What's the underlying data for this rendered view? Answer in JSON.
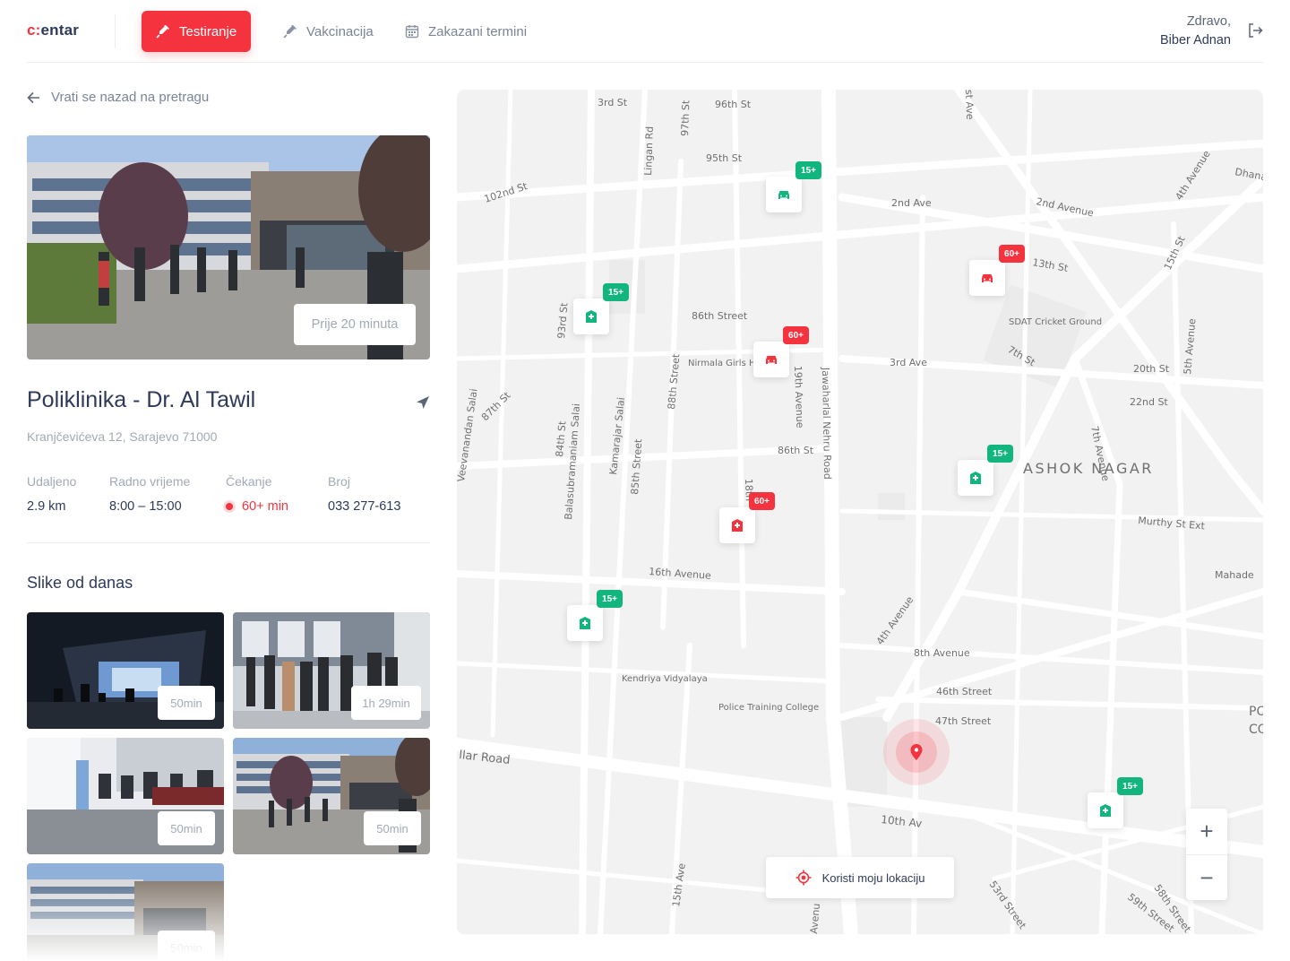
{
  "header": {
    "logo_prefix": "c",
    "logo_suffix": "entar",
    "nav": [
      {
        "label": "Testiranje",
        "icon": "syringe-icon",
        "active": true
      },
      {
        "label": "Vakcinacija",
        "icon": "vaccine-icon",
        "active": false
      },
      {
        "label": "Zakazani termini",
        "icon": "calendar-icon",
        "active": false
      }
    ],
    "greeting": "Zdravo,",
    "user_name": "Biber Adnan",
    "logout_icon": "logout-icon"
  },
  "detail": {
    "back_label": "Vrati se nazad na pretragu",
    "hero_time": "Prije 20 minuta",
    "title": "Poliklinika - Dr. Al Tawil",
    "address": "Kranjčevićeva 12, Sarajevo 71000",
    "stats": [
      {
        "label": "Udaljeno",
        "value": "2.9 km"
      },
      {
        "label": "Radno vrijeme",
        "value": "8:00 – 15:00"
      },
      {
        "label": "Čekanje",
        "value": "60+ min"
      },
      {
        "label": "Broj",
        "value": "033 277-613"
      }
    ],
    "photos_title": "Slike od danas",
    "photos": [
      {
        "time": "50min"
      },
      {
        "time": "1h 29min"
      },
      {
        "time": "50min"
      },
      {
        "time": "50min"
      },
      {
        "time": "50min"
      }
    ]
  },
  "map": {
    "streets": [
      "3rd St",
      "96th St",
      "97th St",
      "Lingan Rd",
      "95th St",
      "102nd St",
      "2nd Ave",
      "2nd Avenue",
      "4th Avenue",
      "Dhana",
      "13th St",
      "15th St",
      "86th Street",
      "93rd St",
      "Nirmala Girls HSS",
      "3rd Ave",
      "SDAT Cricket Ground",
      "7th St",
      "20th St",
      "22nd St",
      "5th Avenue",
      "19th Avenue",
      "Jawaharlal Nehru Road",
      "88th Street",
      "87th St",
      "86th St",
      "84th St",
      "Balasubramaniam Salai",
      "Kamarajar Salai",
      "85th Street",
      "ASHOK NAGAR",
      "7th Avenue",
      "Murthy St Ext",
      "18th",
      "16th Avenue",
      "Mahade",
      "4th Avenue",
      "8th Avenue",
      "46th Street",
      "47th Street",
      "Kendriya Vidyalaya",
      "Police Training College",
      "llar Road",
      "10th Av",
      "15th Ave",
      "53rd Street",
      "58th Street",
      "59th Street",
      "PO",
      "CO",
      "st Ave",
      "Veevanandan Salai",
      "Avenu"
    ],
    "markers": [
      {
        "type": "car",
        "badge": "15+",
        "color": "green"
      },
      {
        "type": "hospital",
        "badge": "15+",
        "color": "green"
      },
      {
        "type": "car",
        "badge": "60+",
        "color": "red"
      },
      {
        "type": "car",
        "badge": "60+",
        "color": "red"
      },
      {
        "type": "hospital",
        "badge": "15+",
        "color": "green"
      },
      {
        "type": "hospital",
        "badge": "60+",
        "color": "red"
      },
      {
        "type": "hospital",
        "badge": "15+",
        "color": "green"
      },
      {
        "type": "hospital",
        "badge": "15+",
        "color": "green"
      }
    ],
    "zoom_in": "+",
    "zoom_out": "−",
    "use_location_label": "Koristi moju lokaciju"
  },
  "colors": {
    "accent": "#f5333f",
    "green": "#13b57f",
    "text": "#2e3a59",
    "muted": "#a2a9b6"
  }
}
